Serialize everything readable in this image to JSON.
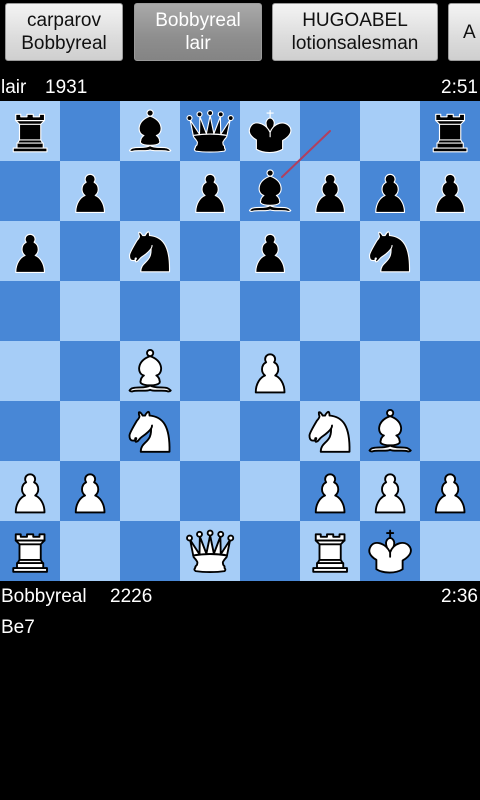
{
  "tabs": [
    {
      "line1": "carparov",
      "line2": "Bobbyreal",
      "active": false
    },
    {
      "line1": "Bobbyreal",
      "line2": "lair",
      "active": true
    },
    {
      "line1": "HUGOABEL",
      "line2": "lotionsalesman",
      "active": false
    },
    {
      "line1": "A",
      "line2": "",
      "active": false
    }
  ],
  "top_player": {
    "name": "lair",
    "rating": "1931",
    "clock": "2:51"
  },
  "bottom_player": {
    "name": "Bobbyreal",
    "rating": "2226",
    "clock": "2:36"
  },
  "last_move": "Be7",
  "colors": {
    "light_square": "#a6cdf7",
    "dark_square": "#4887d6",
    "move_arrow": "#b04060"
  },
  "board": {
    "orientation": "white-bottom",
    "ranks": [
      [
        "r",
        "",
        "b",
        "q",
        "k",
        "",
        "",
        "r"
      ],
      [
        "",
        "p",
        "",
        "p",
        "b",
        "p",
        "p",
        "p"
      ],
      [
        "p",
        "",
        "n",
        "",
        "p",
        "",
        "n",
        ""
      ],
      [
        "",
        "",
        "",
        "",
        "",
        "",
        "",
        ""
      ],
      [
        "",
        "",
        "B",
        "",
        "P",
        "",
        "",
        ""
      ],
      [
        "",
        "",
        "N",
        "",
        "",
        "N",
        "B",
        ""
      ],
      [
        "P",
        "P",
        "",
        "",
        "",
        "P",
        "P",
        "P"
      ],
      [
        "R",
        "",
        "",
        "Q",
        "",
        "R",
        "K",
        ""
      ]
    ],
    "highlight_move": {
      "from": "f8",
      "to": "e7"
    }
  }
}
